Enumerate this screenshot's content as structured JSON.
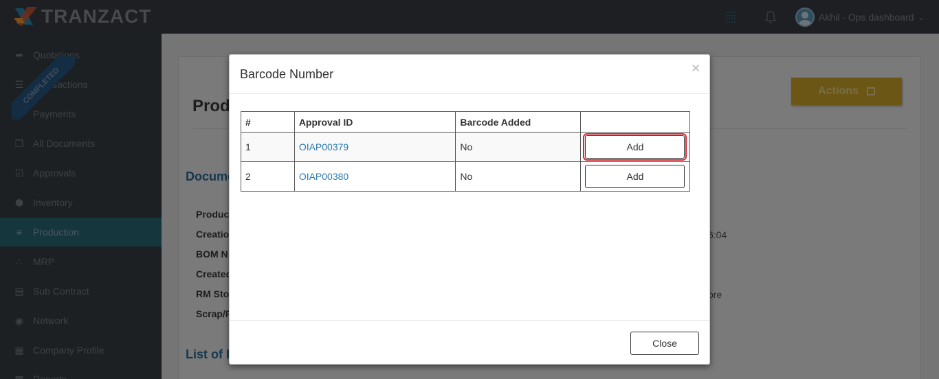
{
  "topbar": {
    "brand": "TRANZACT",
    "user_name": "Akhil - Ops dashboard"
  },
  "sidebar": {
    "items": [
      {
        "label": "Quotations",
        "icon": "share-arrow-icon"
      },
      {
        "label": "Transactions",
        "icon": "list-tree-icon"
      },
      {
        "label": "Payments",
        "icon": "rupee-icon"
      },
      {
        "label": "All Documents",
        "icon": "documents-icon"
      },
      {
        "label": "Approvals",
        "icon": "check-square-icon"
      },
      {
        "label": "Inventory",
        "icon": "box-icon"
      },
      {
        "label": "Production",
        "icon": "production-icon",
        "active": true
      },
      {
        "label": "MRP",
        "icon": "mrp-icon"
      },
      {
        "label": "Sub Contract",
        "icon": "file-icon"
      },
      {
        "label": "Network",
        "icon": "globe-icon"
      },
      {
        "label": "Company Profile",
        "icon": "building-icon"
      },
      {
        "label": "Reports",
        "icon": "report-icon"
      }
    ]
  },
  "background": {
    "ribbon": "COMPLETED",
    "page_title": "Prod",
    "actions_label": "Actions",
    "section_documents": "Docume",
    "section_list": "List of I",
    "fields": [
      "Produc",
      "Creatio",
      "BOM N",
      "Created",
      "RM Sto",
      "Scrap/F"
    ],
    "creation_value_tail": "6:04",
    "rm_store_value_tail": "ore"
  },
  "modal": {
    "title": "Barcode Number",
    "close_x": "×",
    "columns": [
      "#",
      "Approval ID",
      "Barcode Added",
      ""
    ],
    "rows": [
      {
        "num": "1",
        "approval_id": "OIAP00379",
        "barcode_added": "No",
        "action": "Add"
      },
      {
        "num": "2",
        "approval_id": "OIAP00380",
        "barcode_added": "No",
        "action": "Add"
      }
    ],
    "close_label": "Close"
  },
  "colors": {
    "accent": "#2a7ab0",
    "highlight": "#d7262b",
    "sidebar_active": "#2b6c7a",
    "actions_button": "#d6ad2b"
  }
}
